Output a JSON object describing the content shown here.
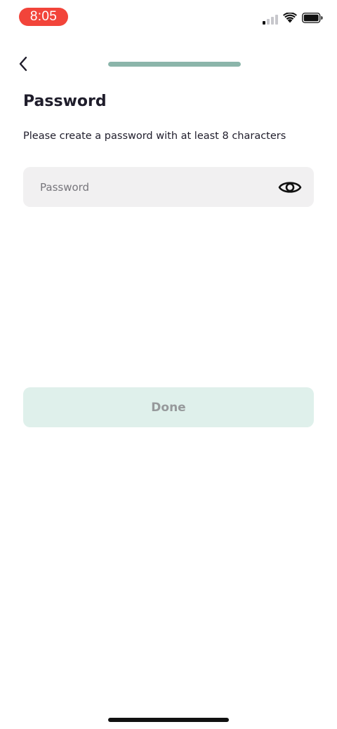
{
  "status_bar": {
    "time": "8:05",
    "time_pill_color": "#f2443a",
    "signal_bars_active": 1,
    "signal_bars_total": 4,
    "icons": [
      "cellular-signal-icon",
      "wifi-icon",
      "battery-icon"
    ]
  },
  "header": {
    "back_icon": "chevron-left-icon",
    "progress": 1.0,
    "progress_color": "#8bb5aa"
  },
  "main": {
    "title": "Password",
    "subtitle": "Please create a password with at least 8 characters",
    "password_field": {
      "value": "",
      "placeholder": "Password",
      "toggle_icon": "eye-icon"
    },
    "done_label": "Done",
    "done_button_color": "#dff0eb"
  }
}
